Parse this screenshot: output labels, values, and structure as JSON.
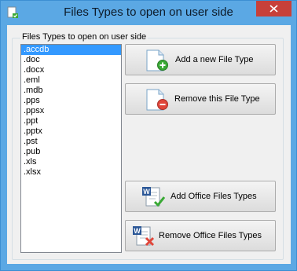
{
  "window": {
    "title": "Files Types to open on user side"
  },
  "group": {
    "label": "Files Types to open on user side"
  },
  "list": {
    "items": [
      ".accdb",
      ".doc",
      ".docx",
      ".eml",
      ".mdb",
      ".pps",
      ".ppsx",
      ".ppt",
      ".pptx",
      ".pst",
      ".pub",
      ".xls",
      ".xlsx"
    ],
    "selected_index": 0
  },
  "buttons": {
    "add_file_type": "Add a new File Type",
    "remove_file_type": "Remove this File Type",
    "add_office": "Add Office Files Types",
    "remove_office": "Remove Office Files Types"
  },
  "colors": {
    "titlebar": "#5ba8e4",
    "close": "#c7403a",
    "selection": "#3399ff",
    "add_badge": "#3aa935",
    "remove_badge": "#e0463a"
  }
}
